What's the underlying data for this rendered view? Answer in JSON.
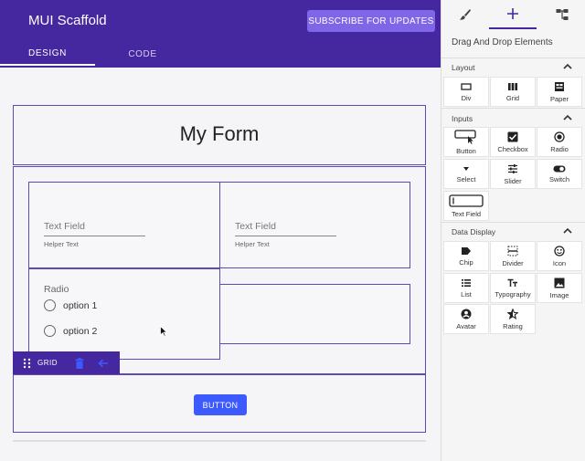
{
  "app": {
    "title": "MUI Scaffold"
  },
  "header": {
    "subscribe_label": "SUBSCRIBE FOR UPDATES",
    "tabs": [
      {
        "label": "DESIGN"
      },
      {
        "label": "CODE"
      }
    ]
  },
  "form": {
    "title": "My Form",
    "text_fields": [
      {
        "label": "Text Field",
        "helper": "Helper Text"
      },
      {
        "label": "Text Field",
        "helper": "Helper Text"
      }
    ],
    "radio": {
      "title": "Radio",
      "options": [
        "option 1",
        "option 2"
      ]
    },
    "grid_toolbar_label": "GRID",
    "button_label": "BUTTON"
  },
  "panel": {
    "tabs": [
      {
        "icon": "paintbrush-icon"
      },
      {
        "icon": "plus-icon"
      },
      {
        "icon": "tree-icon"
      }
    ],
    "heading": "Drag And Drop Elements",
    "sections": [
      {
        "title": "Layout",
        "items": [
          {
            "label": "Div",
            "icon": "div-icon"
          },
          {
            "label": "Grid",
            "icon": "grid-icon"
          },
          {
            "label": "Paper",
            "icon": "paper-icon"
          }
        ]
      },
      {
        "title": "Inputs",
        "items": [
          {
            "label": "Button",
            "icon": "button-icon"
          },
          {
            "label": "Checkbox",
            "icon": "checkbox-icon"
          },
          {
            "label": "Radio",
            "icon": "radio-icon"
          },
          {
            "label": "Select",
            "icon": "select-icon"
          },
          {
            "label": "Slider",
            "icon": "slider-icon"
          },
          {
            "label": "Switch",
            "icon": "switch-icon"
          },
          {
            "label": "Text Field",
            "icon": "textfield-icon"
          }
        ]
      },
      {
        "title": "Data Display",
        "items": [
          {
            "label": "Chip",
            "icon": "chip-icon"
          },
          {
            "label": "Divider",
            "icon": "divider-icon"
          },
          {
            "label": "Icon",
            "icon": "smiley-icon"
          },
          {
            "label": "List",
            "icon": "list-icon"
          },
          {
            "label": "Typography",
            "icon": "typography-icon"
          },
          {
            "label": "Image",
            "icon": "image-icon"
          },
          {
            "label": "Avatar",
            "icon": "avatar-icon"
          },
          {
            "label": "Rating",
            "icon": "rating-icon"
          }
        ]
      }
    ]
  },
  "colors": {
    "primary": "#4527a0",
    "accent": "#3d5afe",
    "subscribe": "#7e66e6"
  }
}
